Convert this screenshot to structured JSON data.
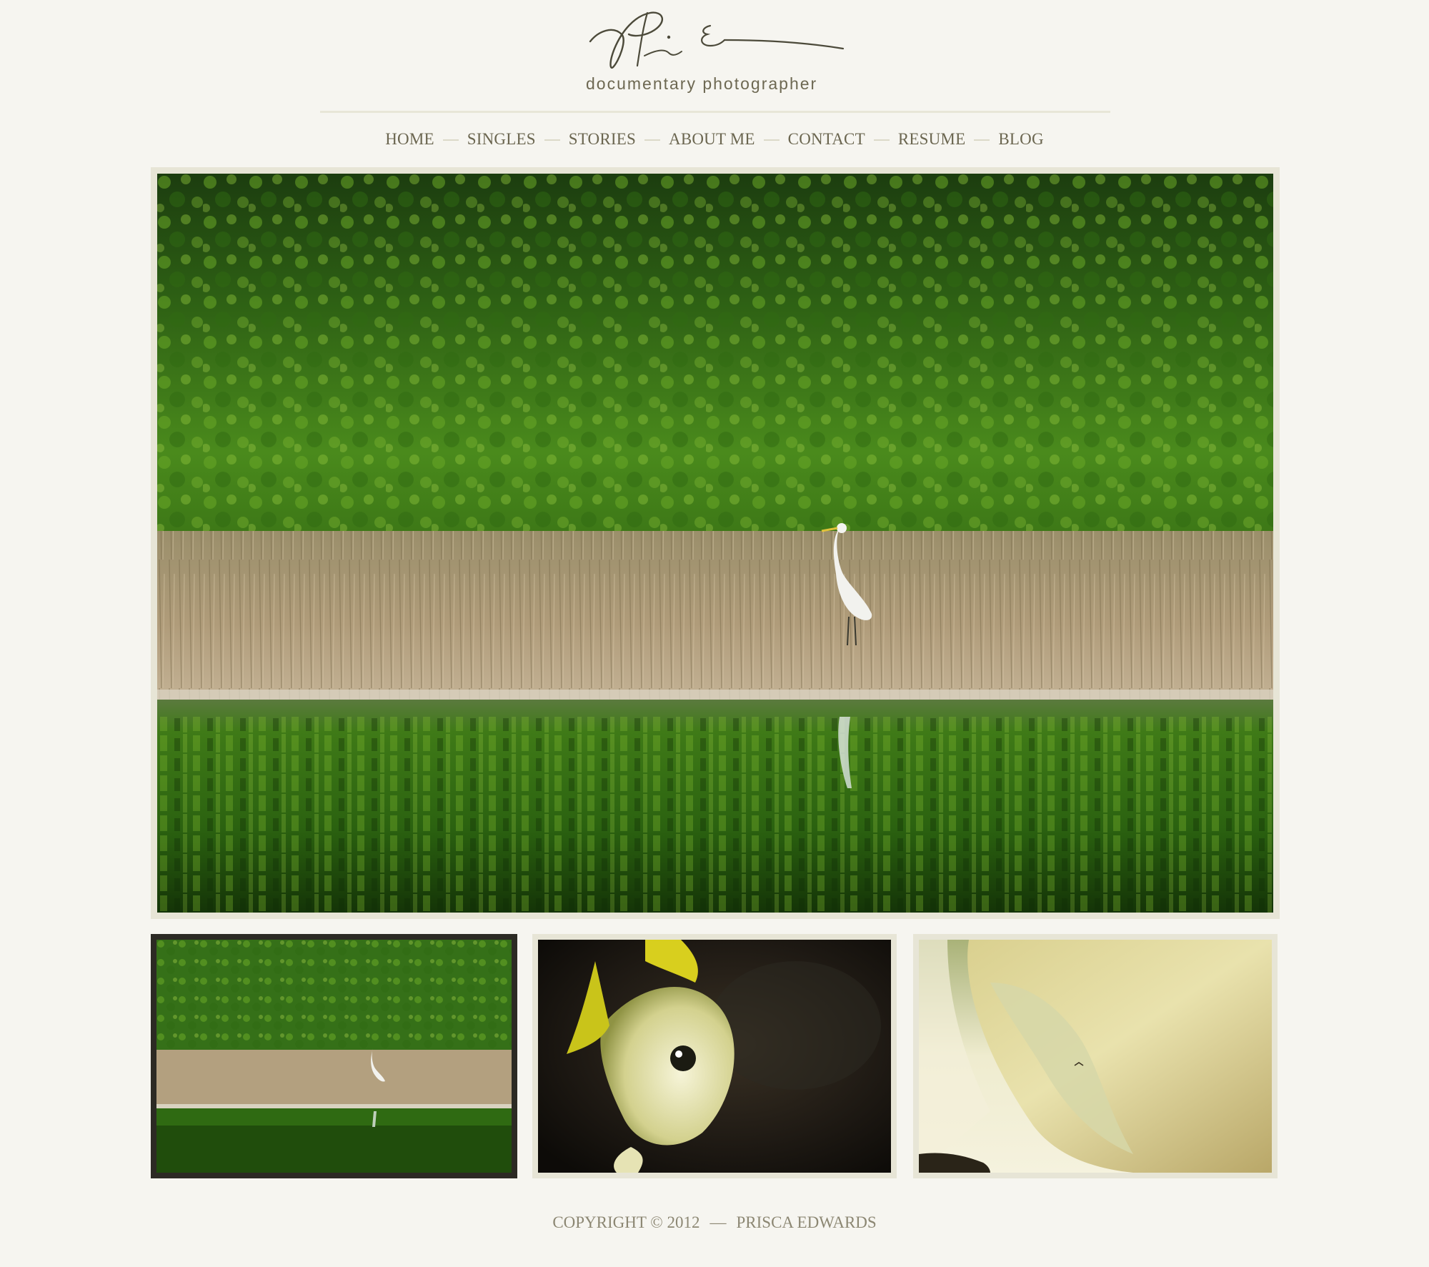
{
  "brand": {
    "signature_alt": "Prisca Edwards signature",
    "tagline": "documentary photographer"
  },
  "nav": {
    "items": [
      {
        "label": "HOME"
      },
      {
        "label": "SINGLES"
      },
      {
        "label": "STORIES"
      },
      {
        "label": "ABOUT ME"
      },
      {
        "label": "CONTACT"
      },
      {
        "label": "RESUME"
      },
      {
        "label": "BLOG"
      }
    ],
    "separator": "—"
  },
  "gallery": {
    "main_image": "egret-in-marsh-photo",
    "thumbnails": [
      {
        "image": "egret-in-marsh-thumbnail",
        "active": true
      },
      {
        "image": "fish-thumbnail",
        "active": false
      },
      {
        "image": "waterfall-thumbnail",
        "active": false
      }
    ]
  },
  "footer": {
    "copyright": "COPYRIGHT © 2012",
    "separator": "—",
    "name": "PRISCA EDWARDS"
  },
  "colors": {
    "background": "#f6f5f0",
    "frame": "#e7e5d6",
    "active_frame": "#2c2a24",
    "text": "#6b6650"
  }
}
